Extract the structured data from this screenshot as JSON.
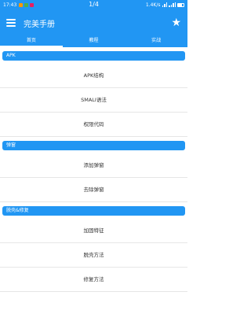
{
  "statusbar": {
    "time": "17:43",
    "page_indicator": "1/4",
    "network_speed": "1.4K/s",
    "notification_colors": [
      "#ff9800",
      "#4caf50",
      "#e91e63"
    ]
  },
  "toolbar": {
    "title": "完美手册"
  },
  "tabs": [
    {
      "label": "首页",
      "active": true
    },
    {
      "label": "教程",
      "active": false
    },
    {
      "label": "实战",
      "active": false
    }
  ],
  "sections": [
    {
      "header": "APK",
      "items": [
        "APK结构",
        "SMALI语法",
        "权限代码"
      ]
    },
    {
      "header": "弹窗",
      "items": [
        "添加弹窗",
        "去除弹窗"
      ]
    },
    {
      "header": "脱壳&修复",
      "items": [
        "加固特征",
        "脱壳方法",
        "修复方法"
      ]
    }
  ],
  "colors": {
    "primary": "#2196f3",
    "text": "#333333",
    "divider": "#e6e6e6"
  }
}
